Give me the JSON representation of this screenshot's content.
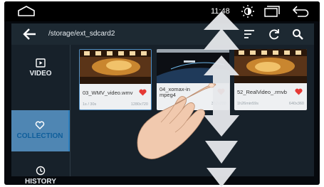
{
  "status_bar": {
    "time": "11:48",
    "icons": [
      "home-icon",
      "brightness-icon",
      "recent-apps-icon",
      "back-icon"
    ]
  },
  "toolbar": {
    "path": "/storage/ext_sdcard2",
    "icons": [
      "back-arrow-icon",
      "sort-icon",
      "refresh-icon",
      "search-icon"
    ]
  },
  "sidebar": {
    "items": [
      {
        "label": "VIDEO",
        "icon": "play-folder-icon",
        "selected": false
      },
      {
        "label": "COLLECTION",
        "icon": "heart-outline-icon",
        "selected": true
      },
      {
        "label": "HISTORY",
        "icon": "clock-icon",
        "selected": false
      }
    ]
  },
  "videos": [
    {
      "name": "03_WMV_video.wmv",
      "progress": "1s / 30s",
      "resolution": "1280x720",
      "favorite": true
    },
    {
      "name": "04_xomax-in\nmpeg4",
      "progress": "",
      "resolution": "352x288",
      "favorite": true
    },
    {
      "name": "52_RealVideo_.rmvb",
      "progress": "1h26min59s",
      "resolution": "640x360",
      "favorite": true
    }
  ],
  "colors": {
    "accent": "#2b7fc0",
    "favorite": "#e53935",
    "background": "#17212a"
  },
  "gesture": "swipe-down"
}
